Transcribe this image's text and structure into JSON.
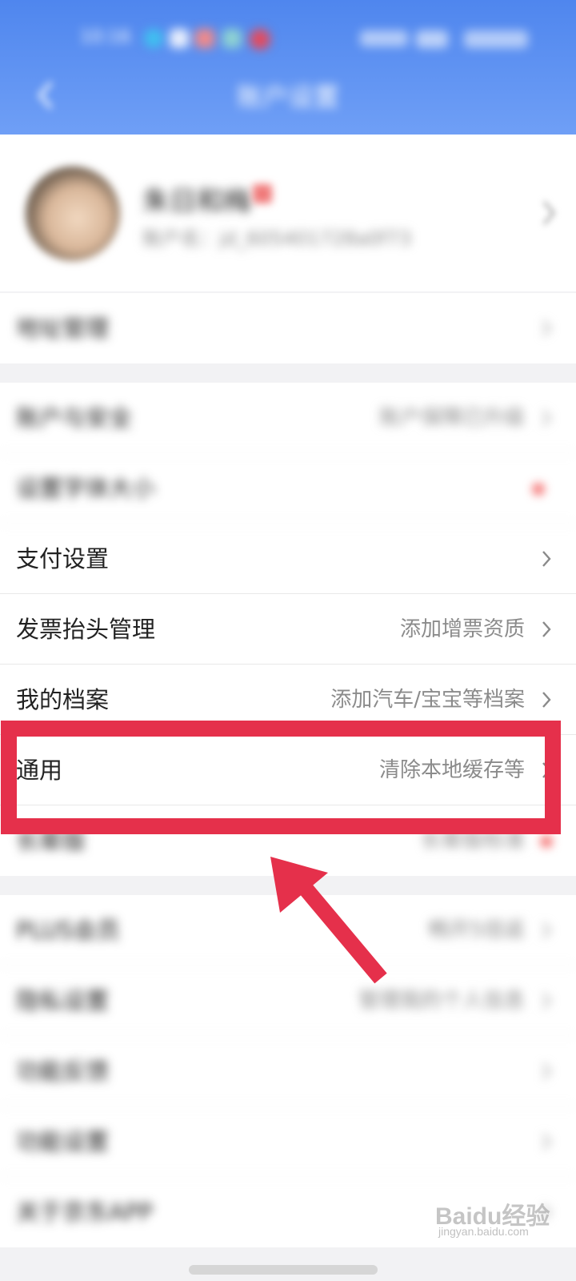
{
  "header": {
    "title": "账户设置",
    "time": "10:16",
    "battery": "54%"
  },
  "profile": {
    "name": "朱日和梅",
    "account": "账户名：jd_605401728a0f73"
  },
  "groups": [
    {
      "rows": [
        {
          "label": "地址管理",
          "value": "",
          "icon": "chevron-right-icon",
          "blurred": true
        }
      ]
    },
    {
      "rows": [
        {
          "label": "账户与安全",
          "value": "账户保障已升级",
          "icon": "chevron-right-icon",
          "blurred": true
        },
        {
          "label": "设置字体大小",
          "value": "",
          "icon": "red-dot-icon",
          "blurred": true
        },
        {
          "label": "支付设置",
          "value": "",
          "icon": "chevron-right-icon",
          "blurred": false
        },
        {
          "label": "发票抬头管理",
          "value": "添加增票资质",
          "icon": "chevron-right-icon",
          "blurred": false
        },
        {
          "label": "我的档案",
          "value": "添加汽车/宝宝等档案",
          "icon": "chevron-right-icon",
          "blurred": false
        },
        {
          "label": "通用",
          "value": "清除本地缓存等",
          "icon": "chevron-right-icon",
          "blurred": false
        },
        {
          "label": "长辈版",
          "value": "长辈版标准",
          "icon": "red-dot-icon",
          "blurred": true
        }
      ]
    },
    {
      "rows": [
        {
          "label": "PLUS会员",
          "value": "畅开5倍返",
          "icon": "chevron-right-icon",
          "blurred": true
        },
        {
          "label": "隐私设置",
          "value": "管理我的个人信息",
          "icon": "chevron-right-icon",
          "blurred": true
        },
        {
          "label": "功能反馈",
          "value": "",
          "icon": "chevron-right-icon",
          "blurred": true
        },
        {
          "label": "功能设置",
          "value": "",
          "icon": "chevron-right-icon",
          "blurred": true
        },
        {
          "label": "关于京东APP",
          "value": "",
          "icon": "chevron-right-icon",
          "blurred": true
        }
      ]
    }
  ],
  "watermark": {
    "brand": "Baidu经验",
    "url": "jingyan.baidu.com"
  },
  "colors": {
    "header_top": "#4f86ee",
    "header_bottom": "#6f9ff6",
    "highlight": "#e5304b",
    "badge": "#f25454"
  }
}
